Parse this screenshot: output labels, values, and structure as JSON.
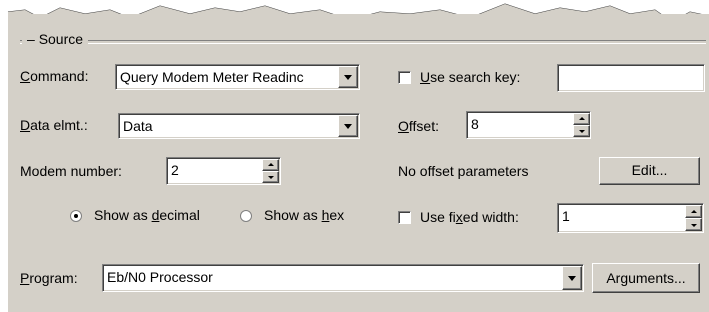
{
  "group": {
    "title": "Source"
  },
  "command": {
    "label_pre": "",
    "label_ul": "C",
    "label_post": "ommand:",
    "value": "Query Modem Meter Readinc"
  },
  "data_elmt": {
    "label_pre": "",
    "label_ul": "D",
    "label_post": "ata elmt.:",
    "value": "Data"
  },
  "modem_number": {
    "label": "Modem number:",
    "value": "2"
  },
  "radio": {
    "decimal": {
      "label_pre": "Show as ",
      "label_ul": "d",
      "label_post": "ecimal",
      "selected": true
    },
    "hex": {
      "label_pre": "Show as ",
      "label_ul": "h",
      "label_post": "ex",
      "selected": false
    }
  },
  "search_key": {
    "label_pre": "",
    "label_ul": "U",
    "label_post": "se search key:",
    "checked": false,
    "value": ""
  },
  "offset": {
    "label_pre": "",
    "label_ul": "O",
    "label_post": "ffset:",
    "value": "8"
  },
  "offset_params": {
    "text": "No offset parameters",
    "button": "Edit..."
  },
  "fixed_width": {
    "label_pre": "Use fi",
    "label_ul": "x",
    "label_post": "ed width:",
    "checked": false,
    "value": "1"
  },
  "program": {
    "label_pre": "",
    "label_ul": "P",
    "label_post": "rogram:",
    "value": "Eb/N0 Processor",
    "button": "Arguments..."
  }
}
